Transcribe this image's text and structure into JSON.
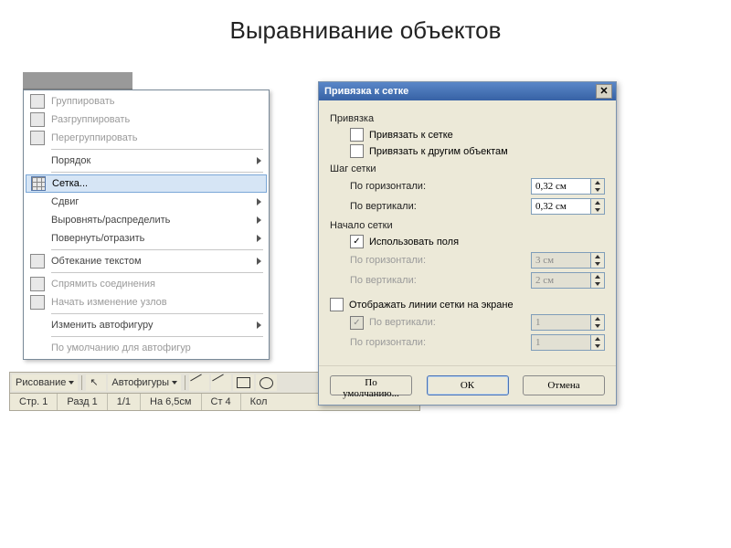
{
  "title": "Выравнивание объектов",
  "context_menu": {
    "items": [
      {
        "label": "Группировать",
        "has_sub": false,
        "disabled": true
      },
      {
        "label": "Разгруппировать",
        "has_sub": false,
        "disabled": true
      },
      {
        "label": "Перегруппировать",
        "has_sub": false,
        "disabled": true
      },
      {
        "label": "Порядок",
        "has_sub": true,
        "disabled": false
      },
      {
        "label": "Сетка...",
        "has_sub": false,
        "disabled": false,
        "highlighted": true,
        "icon": "grid-icon"
      },
      {
        "label": "Сдвиг",
        "has_sub": true,
        "disabled": false
      },
      {
        "label": "Выровнять/распределить",
        "has_sub": true,
        "disabled": false
      },
      {
        "label": "Повернуть/отразить",
        "has_sub": true,
        "disabled": false
      },
      {
        "label": "Обтекание текстом",
        "has_sub": true,
        "disabled": false,
        "icon": "textwrap-icon"
      },
      {
        "label": "Спрямить соединения",
        "has_sub": false,
        "disabled": true,
        "icon": "straighten-icon"
      },
      {
        "label": "Начать изменение узлов",
        "has_sub": false,
        "disabled": true,
        "icon": "editnodes-icon"
      },
      {
        "label": "Изменить автофигуру",
        "has_sub": true,
        "disabled": false
      },
      {
        "label": "По умолчанию для автофигур",
        "has_sub": false,
        "disabled": true
      }
    ]
  },
  "draw_toolbar": {
    "drawing_label": "Рисование",
    "autoshapes_label": "Автофигуры"
  },
  "status": {
    "page_label": "Стр. 1",
    "section_label": "Разд 1",
    "pages": "1/1",
    "position": "На 6,5см",
    "line": "Ст 4",
    "col": "Кол"
  },
  "dialog": {
    "title": "Привязка к сетке",
    "group_snap": "Привязка",
    "snap_to_grid": "Привязать к сетке",
    "snap_to_objects": "Привязать к другим объектам",
    "group_step": "Шаг сетки",
    "h_spacing_label": "По горизонтали:",
    "v_spacing_label": "По вертикали:",
    "h_spacing_value": "0,32 см",
    "v_spacing_value": "0,32 см",
    "group_origin": "Начало сетки",
    "use_margins": "Использовать поля",
    "origin_h_label": "По горизонтали:",
    "origin_v_label": "По вертикали:",
    "origin_h_value": "3 см",
    "origin_v_value": "2 см",
    "show_gridlines": "Отображать линии сетки на экране",
    "show_v_label": "По вертикали:",
    "show_h_label": "По горизонтали:",
    "show_v_value": "1",
    "show_h_value": "1",
    "btn_default": "По умолчанию...",
    "btn_ok": "ОК",
    "btn_cancel": "Отмена"
  }
}
